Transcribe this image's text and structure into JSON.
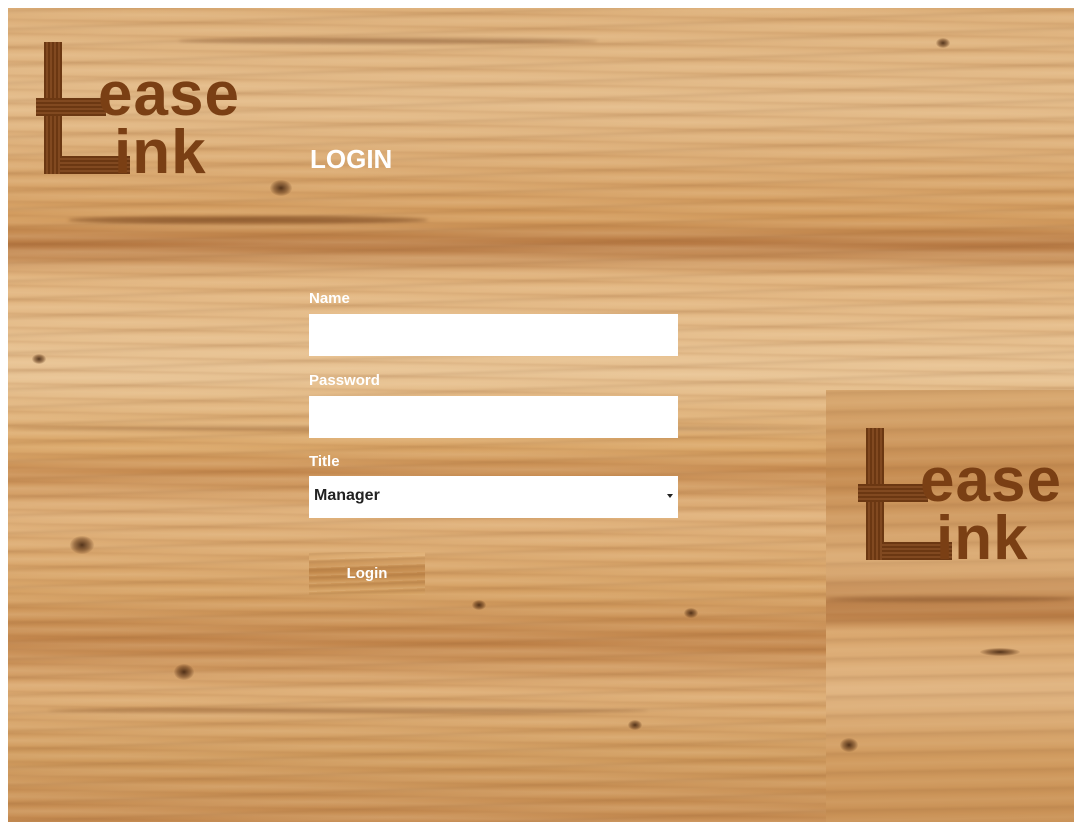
{
  "brand": {
    "logo_line1": "ease",
    "logo_line2": "ink",
    "logo_color": "#7a3f14"
  },
  "login_form": {
    "title": "LOGIN",
    "name_label": "Name",
    "name_value": "",
    "password_label": "Password",
    "password_value": "",
    "title_label": "Title",
    "title_selected": "Manager",
    "submit_label": "Login"
  },
  "colors": {
    "text": "#ffffff",
    "wood": "#d9a66c"
  }
}
